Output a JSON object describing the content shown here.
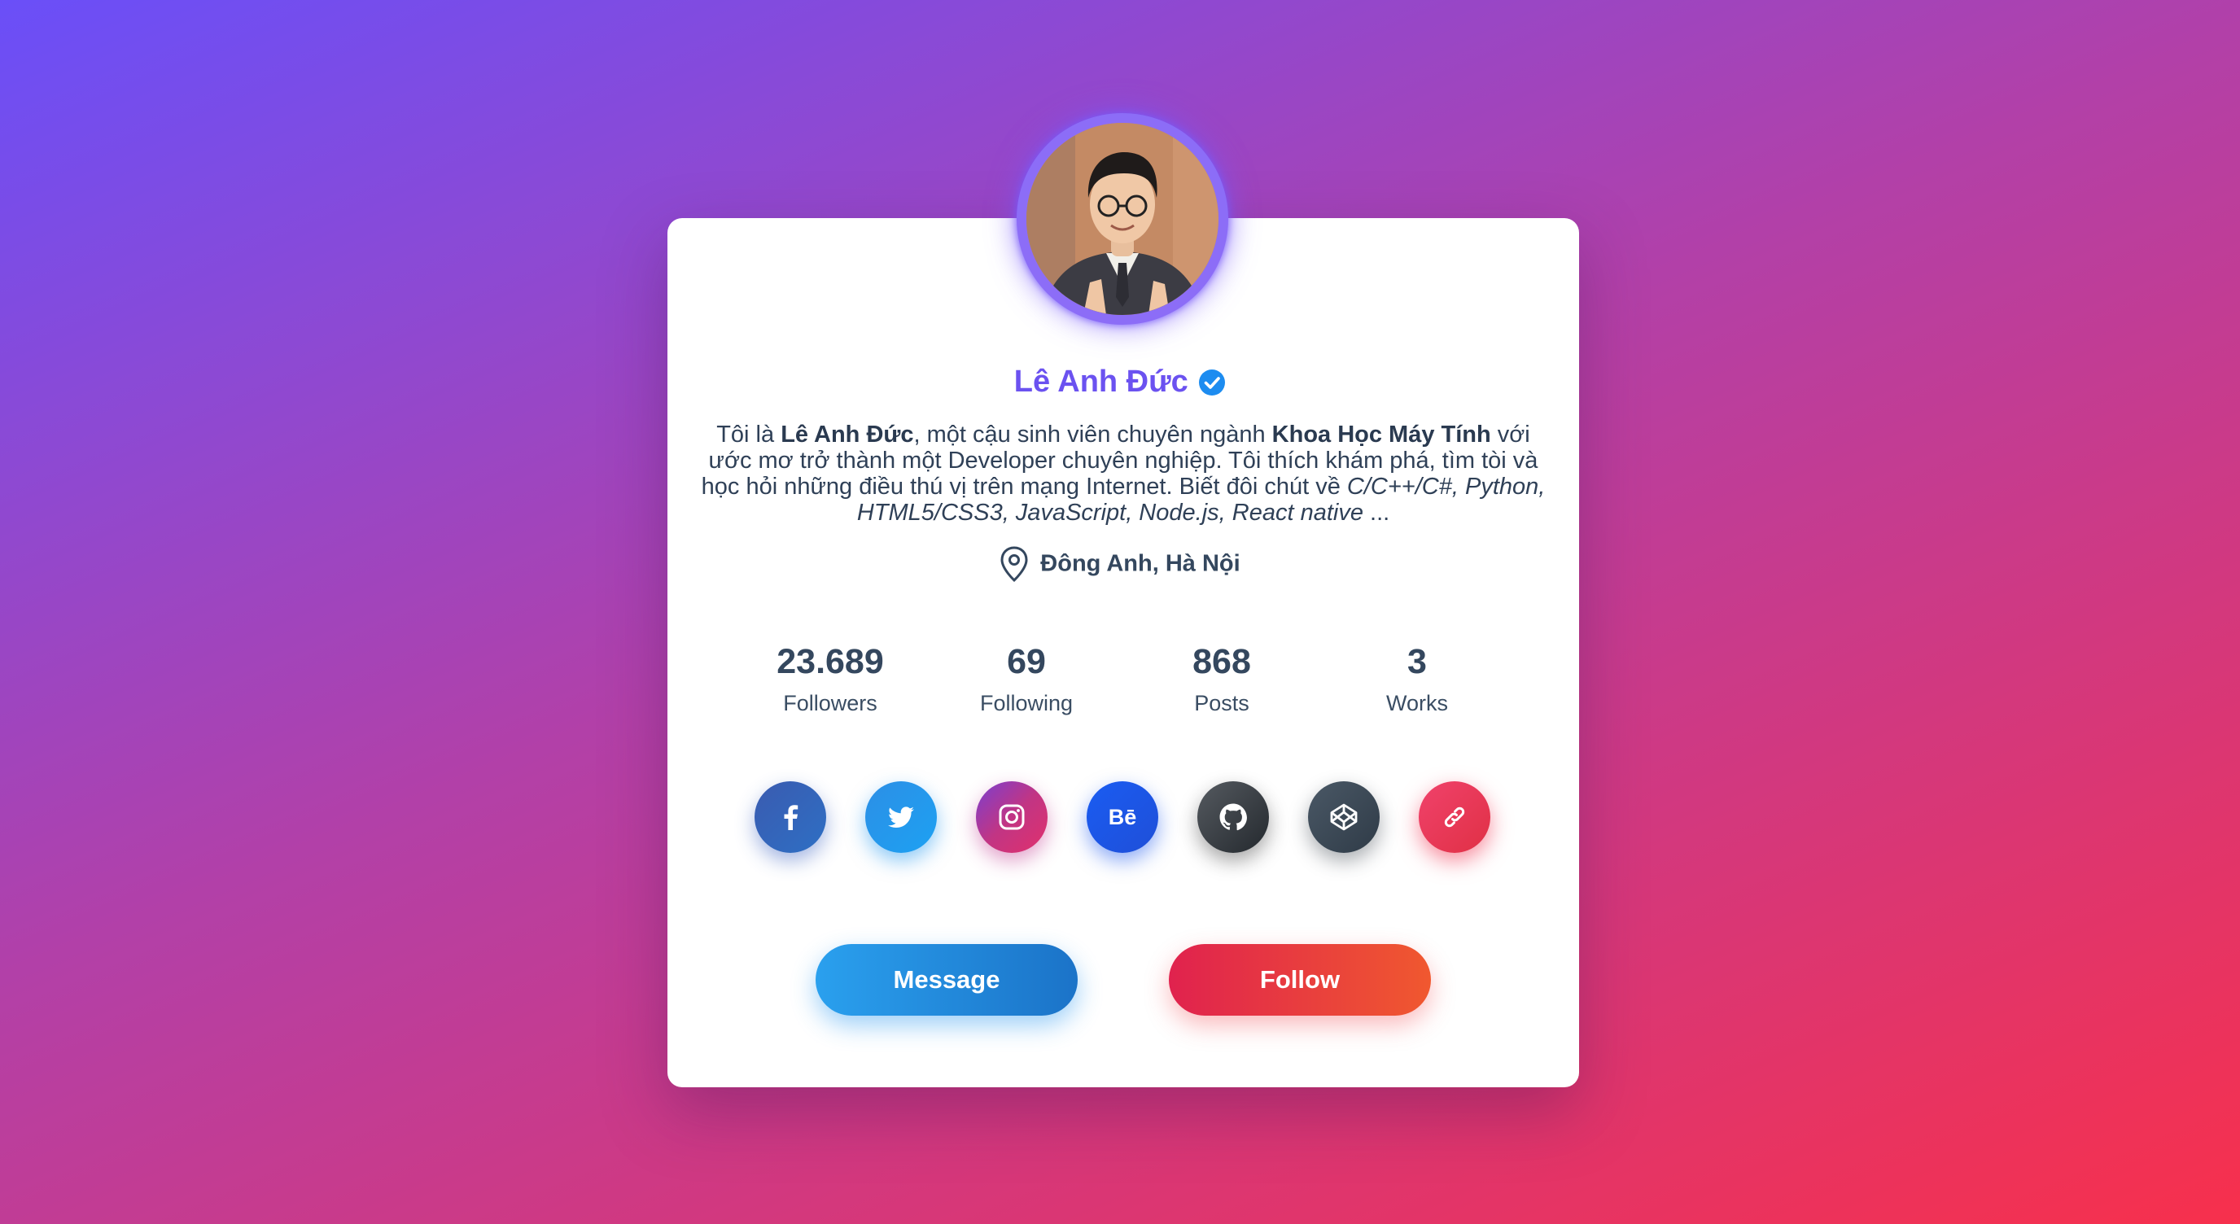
{
  "profile": {
    "name": "Lê Anh Đức",
    "bio": {
      "p1": "Tôi là ",
      "name_bold": "Lê Anh Đức",
      "p2": ", một cậu sinh viên chuyên ngành ",
      "major_bold": "Khoa Học Máy Tính",
      "p3": " với ước mơ trở thành một Developer chuyên nghiệp. Tôi thích khám phá, tìm tòi và học hỏi những điều thú vị trên mạng Internet. Biết đôi chút về ",
      "skills_italic": "C/C++/C#, Python, HTML5/CSS3, JavaScript, Node.js, React native",
      "p4": " ..."
    },
    "location": "Đông Anh, Hà Nội"
  },
  "stats": [
    {
      "value": "23.689",
      "label": "Followers"
    },
    {
      "value": "69",
      "label": "Following"
    },
    {
      "value": "868",
      "label": "Posts"
    },
    {
      "value": "3",
      "label": "Works"
    }
  ],
  "social": [
    {
      "icon": "facebook-icon"
    },
    {
      "icon": "twitter-icon"
    },
    {
      "icon": "instagram-icon"
    },
    {
      "icon": "behance-icon",
      "text": "Bē"
    },
    {
      "icon": "github-icon"
    },
    {
      "icon": "codepen-icon"
    },
    {
      "icon": "link-icon"
    }
  ],
  "buttons": {
    "message": "Message",
    "follow": "Follow"
  },
  "colors": {
    "name": "#6b52f0",
    "text": "#2f4057",
    "background_start": "#6a4ff8",
    "background_end": "#f7304c",
    "message_button": "#2aa0ee",
    "follow_button": "#e0224e",
    "verified_badge": "#1d8cf0"
  }
}
